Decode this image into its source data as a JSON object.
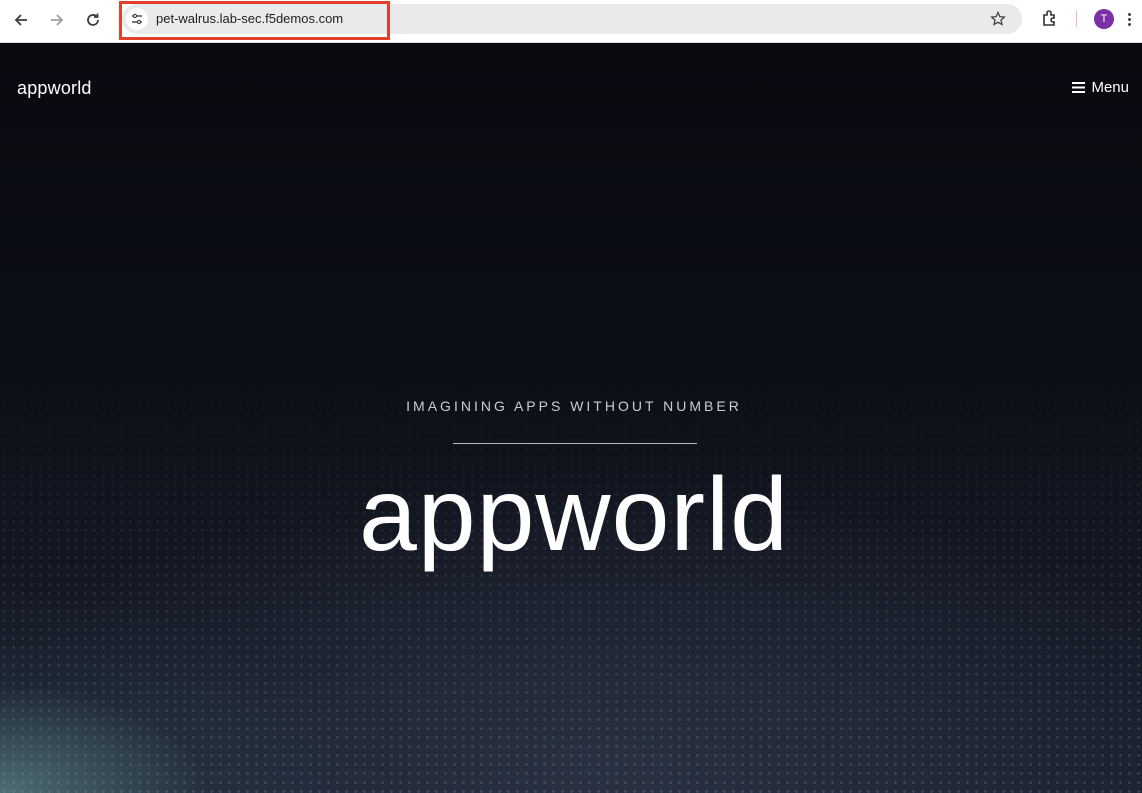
{
  "browser": {
    "url": "pet-walrus.lab-sec.f5demos.com",
    "profile_initial": "T",
    "colors": {
      "highlight": "#e2402c",
      "avatar": "#7b2fa6"
    }
  },
  "site": {
    "logo": "appworld",
    "menu_label": "Menu",
    "tagline": "IMAGINING APPS WITHOUT NUMBER",
    "hero_title": "appworld"
  }
}
